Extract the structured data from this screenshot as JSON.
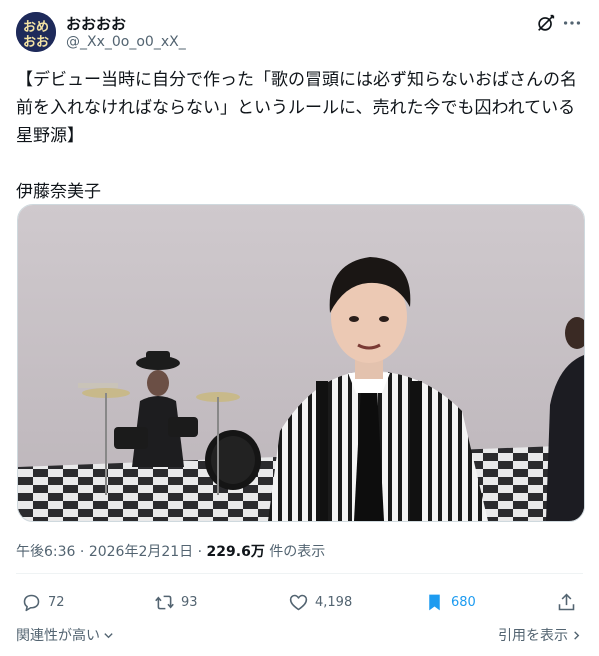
{
  "author": {
    "display_name": "おおおお",
    "handle": "@_Xx_0o_o0_xX_"
  },
  "tweet": {
    "text": "【デビュー当時に自分で作った「歌の冒頭には必ず知らないおばさんの名前を入れなければならない」というルールに、売れた今でも囚われている星野源】\n\n伊藤奈美子"
  },
  "meta": {
    "time": "午後6:36",
    "separator": "·",
    "date": "2026年2月21日",
    "views_count": "229.6万",
    "views_label": "件の表示"
  },
  "actions": {
    "reply_count": "72",
    "retweet_count": "93",
    "like_count": "4,198",
    "bookmark_count": "680"
  },
  "footer": {
    "sort_label": "関連性が高い",
    "quote_label": "引用を表示"
  },
  "icons": {
    "top_right": [
      "no-grok-icon",
      "more-icon"
    ],
    "actions": [
      "reply-icon",
      "retweet-icon",
      "like-icon",
      "bookmark-icon",
      "share-icon"
    ]
  },
  "colors": {
    "accent": "#1d9bf0",
    "secondary_text": "#536471",
    "primary_text": "#0f1419"
  }
}
